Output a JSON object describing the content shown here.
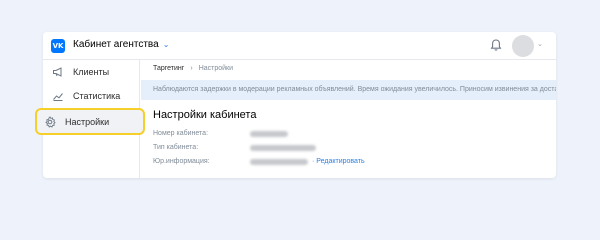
{
  "header": {
    "logo_text": "VK",
    "title": "Кабинет агентства"
  },
  "sidebar": {
    "items": [
      {
        "label": "Клиенты"
      },
      {
        "label": "Статистика"
      },
      {
        "label": "Настройки"
      }
    ]
  },
  "breadcrumb": [
    "Таргетинг",
    "Настройки"
  ],
  "notice": "Наблюдаются задержки в модерации рекламных объявлений. Время ожидания увеличилось. Приносим извинения за доставленные неудобства",
  "settings": {
    "title": "Настройки кабинета",
    "rows": [
      {
        "label": "Номер кабинета:"
      },
      {
        "label": "Тип кабинета:"
      },
      {
        "label": "Юр.информация:",
        "link": "Редактировать"
      }
    ]
  },
  "colors": {
    "accent": "#0077ff",
    "highlight": "#f5d02b",
    "link": "#2d81e0",
    "notice_bg": "#e5eefb"
  }
}
